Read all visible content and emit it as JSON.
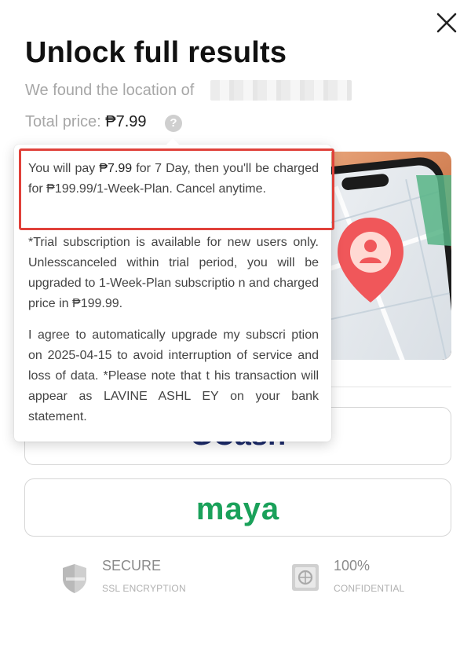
{
  "header": {
    "title": "Unlock full results",
    "found_text": "We found the location of",
    "total_label": "Total price:",
    "total_price": "₱7.99",
    "help_symbol": "?"
  },
  "tooltip": {
    "line1_prefix": "You will pay ",
    "line1_price": "₱7.99",
    "line1_suffix": " for 7 Day, then you'll be charged for ₱199.99/1-Week-Plan. Cancel anytime.",
    "para2": "*Trial subscription is available for new users only. Unlesscanceled within trial period, you will be upgraded to 1-Week-Plan subscriptio n and charged price in ₱199.99.",
    "para3": "I agree to automatically upgrade my subscri ption on 2025-04-15 to avoid interruption of service and loss of data. *Please note that t his transaction will appear as LAVINE ASHL EY on your bank statement."
  },
  "payment": {
    "gcash_label": "GCash",
    "maya_label": "maya"
  },
  "badges": {
    "secure_title": "SECURE",
    "secure_sub": "SSL ENCRYPTION",
    "confidential_title": "100%",
    "confidential_sub": "CONFIDENTIAL"
  },
  "colors": {
    "highlight": "#e0413a",
    "maya_green": "#1aa15a",
    "gcash_blue": "#1c2b6b",
    "pin_red": "#f0575a"
  },
  "icons": [
    "close-icon",
    "help-icon",
    "shield-icon",
    "safe-icon",
    "location-pin-icon",
    "phone-icon"
  ]
}
